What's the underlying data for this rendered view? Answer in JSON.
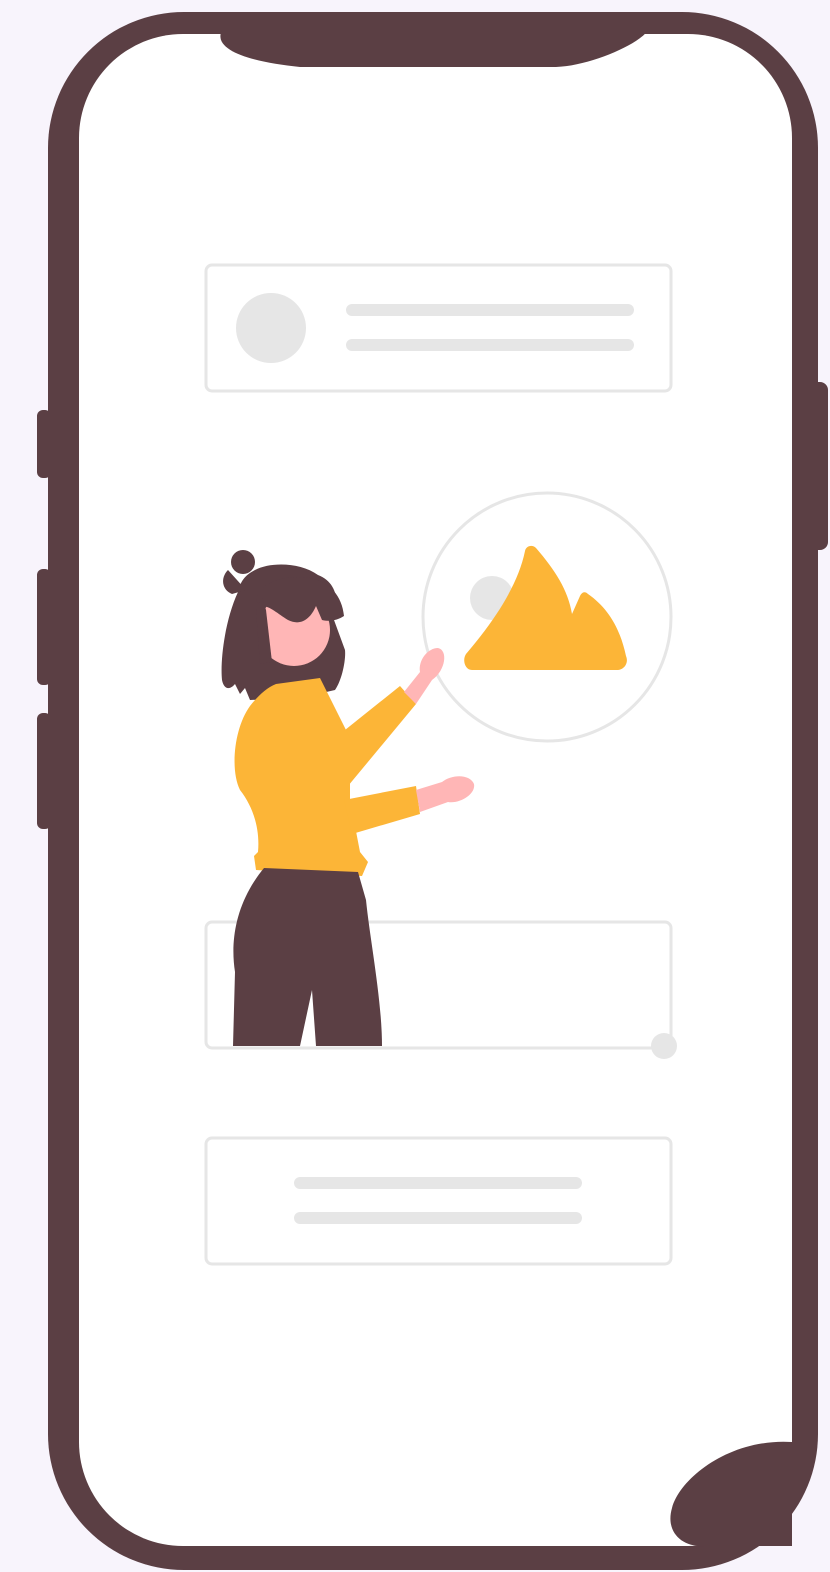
{
  "colors": {
    "background": "#f8f4fc",
    "phone_frame": "#5b3f44",
    "screen": "#ffffff",
    "placeholder_gray": "#e6e6e6",
    "accent_yellow": "#fcb537",
    "skin": "#ffb6b6"
  },
  "illustration": {
    "subject": "phone-mockup-with-person",
    "placeholder_cards": 3,
    "image_placeholder_icon": "mountain-image-icon"
  }
}
